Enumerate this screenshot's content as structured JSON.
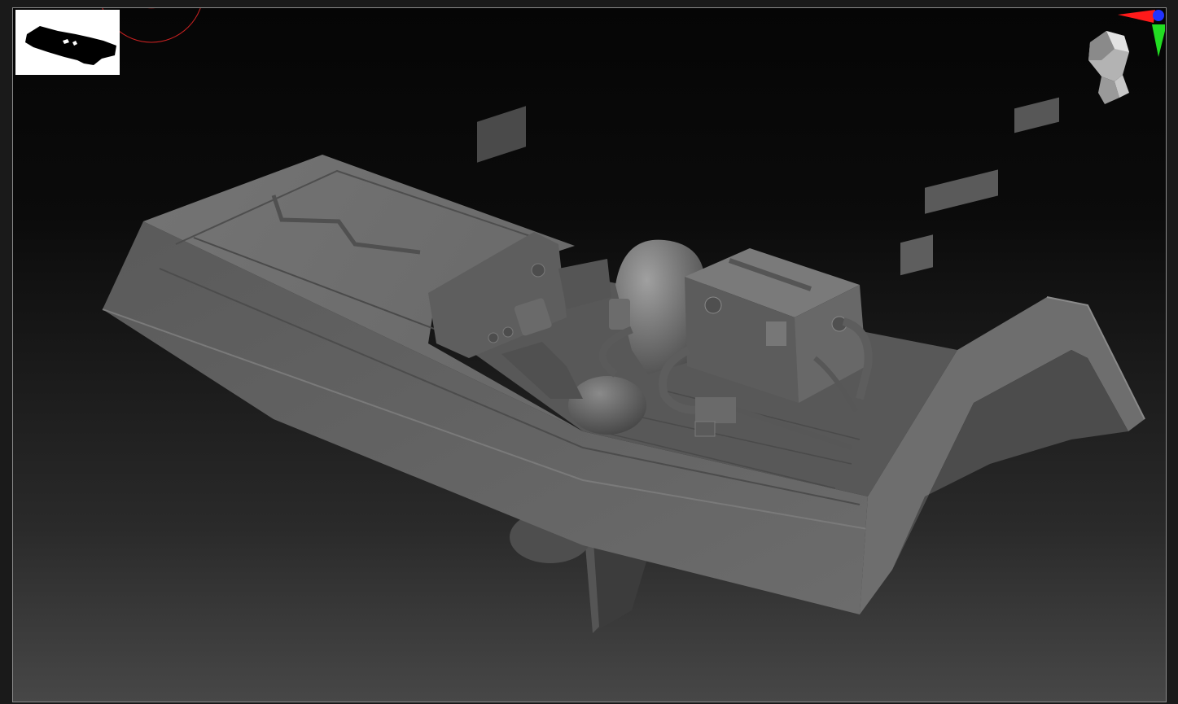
{
  "app": {
    "name": "",
    "view": "3d-viewport"
  },
  "colors": {
    "background_top": "#050505",
    "background_bottom": "#474747",
    "frame_border": "#8a8a8a",
    "model_base": "#6b6b6b",
    "model_shadow": "#3a3a3a",
    "model_highlight": "#9a9a9a",
    "axis_x": "#ff1a1a",
    "axis_y": "#22dd22",
    "axis_z": "#2233ff",
    "brush_ring": "#cc2222"
  },
  "icons": {
    "thumbnail": "model-silhouette-icon",
    "navigation": "head-navigation-icon",
    "gizmo": "axis-gizmo-icon"
  }
}
